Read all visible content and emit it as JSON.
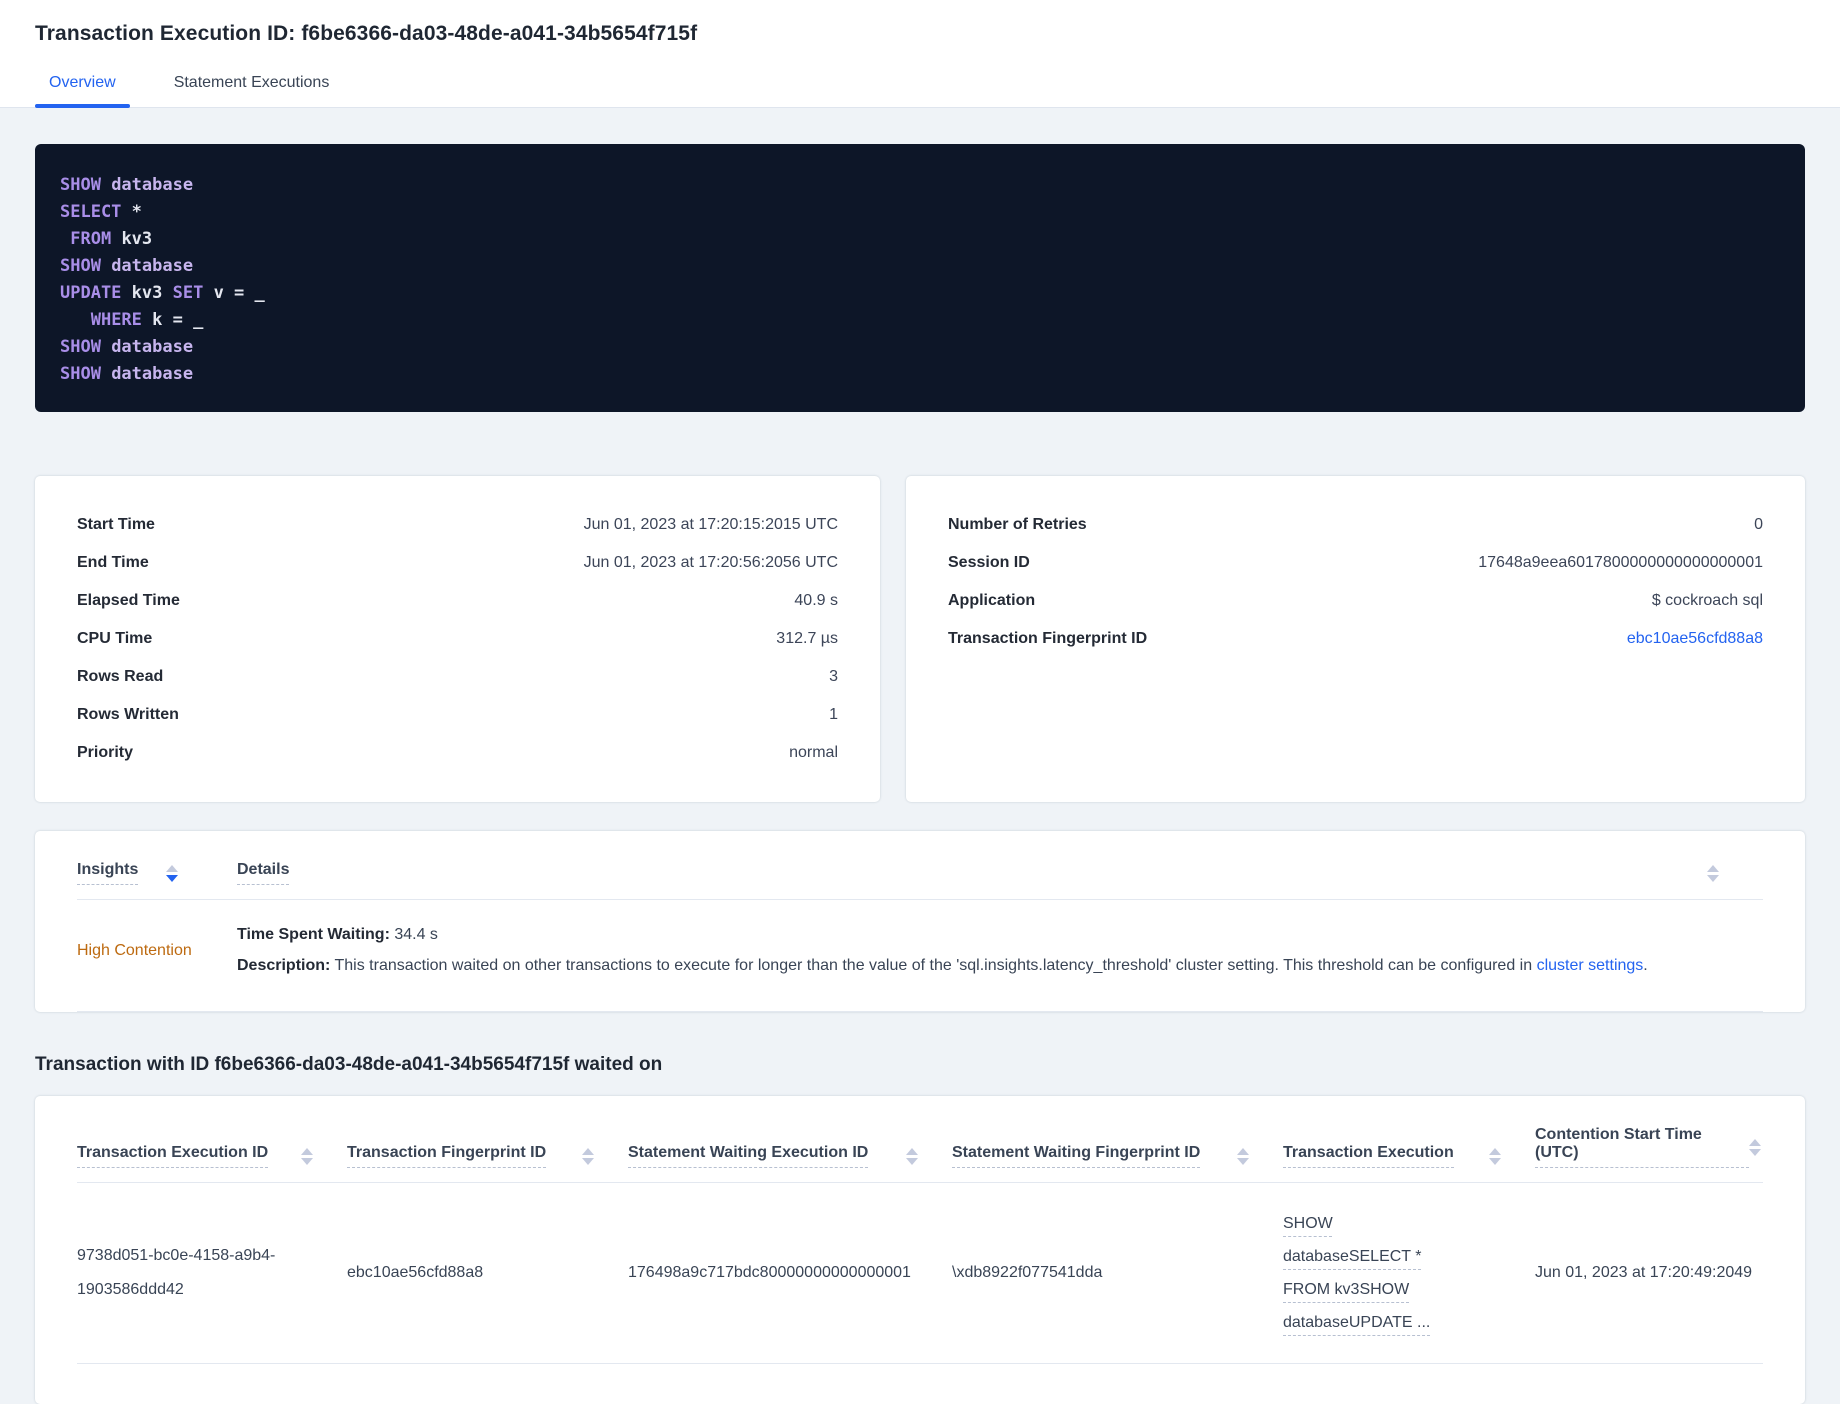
{
  "header": {
    "title": "Transaction Execution ID: f6be6366-da03-48de-a041-34b5654f715f",
    "tabs": [
      {
        "label": "Overview",
        "active": true
      },
      {
        "label": "Statement Executions",
        "active": false
      }
    ]
  },
  "colors": {
    "accent_blue": "#2363f0",
    "warning_orange": "#bd6a10",
    "code_background": "#0d1628",
    "code_keyword": "#a98ee8",
    "code_identifier": "#c7b5ee",
    "code_plain": "#e4e7f0"
  },
  "icons": {
    "sort_icon": "sort-arrows"
  },
  "sql_statements": {
    "lines": [
      {
        "tokens": [
          {
            "text": "SHOW ",
            "type": "kw"
          },
          {
            "text": "database",
            "type": "ident"
          }
        ]
      },
      {
        "tokens": [
          {
            "text": "SELECT ",
            "type": "kw"
          },
          {
            "text": "*",
            "type": "plain"
          }
        ]
      },
      {
        "tokens": [
          {
            "text": " ",
            "type": "plain"
          },
          {
            "text": "FROM ",
            "type": "kw"
          },
          {
            "text": "kv3",
            "type": "plain"
          }
        ]
      },
      {
        "tokens": [
          {
            "text": "SHOW ",
            "type": "kw"
          },
          {
            "text": "database",
            "type": "ident"
          }
        ]
      },
      {
        "tokens": [
          {
            "text": "UPDATE ",
            "type": "kw"
          },
          {
            "text": "kv3 ",
            "type": "plain"
          },
          {
            "text": "SET ",
            "type": "kw"
          },
          {
            "text": "v = _",
            "type": "plain"
          }
        ]
      },
      {
        "tokens": [
          {
            "text": "   ",
            "type": "plain"
          },
          {
            "text": "WHERE ",
            "type": "kw"
          },
          {
            "text": "k = _",
            "type": "plain"
          }
        ]
      },
      {
        "tokens": [
          {
            "text": "SHOW ",
            "type": "kw"
          },
          {
            "text": "database",
            "type": "ident"
          }
        ]
      },
      {
        "tokens": [
          {
            "text": "SHOW ",
            "type": "kw"
          },
          {
            "text": "database",
            "type": "ident"
          }
        ]
      }
    ]
  },
  "summary_left": {
    "rows": [
      {
        "label": "Start Time",
        "value": "Jun 01, 2023 at 17:20:15:2015 UTC"
      },
      {
        "label": "End Time",
        "value": "Jun 01, 2023 at 17:20:56:2056 UTC"
      },
      {
        "label": "Elapsed Time",
        "value": "40.9 s"
      },
      {
        "label": "CPU Time",
        "value": "312.7 µs"
      },
      {
        "label": "Rows Read",
        "value": "3"
      },
      {
        "label": "Rows Written",
        "value": "1"
      },
      {
        "label": "Priority",
        "value": "normal"
      }
    ]
  },
  "summary_right": {
    "rows": [
      {
        "label": "Number of Retries",
        "value": "0"
      },
      {
        "label": "Session ID",
        "value": "17648a9eea6017800000000000000001"
      },
      {
        "label": "Application",
        "value": "$ cockroach sql"
      },
      {
        "label": "Transaction Fingerprint ID",
        "value": "ebc10ae56cfd88a8",
        "link": true
      }
    ]
  },
  "insights_table": {
    "columns": [
      "Insights",
      "Details"
    ],
    "row": {
      "insight": "High Contention",
      "waiting_label": "Time Spent Waiting:",
      "waiting_value": "34.4 s",
      "description_label": "Description:",
      "description_text": "This transaction waited on other transactions to execute for longer than the value of the 'sql.insights.latency_threshold' cluster setting. This threshold can be configured in",
      "description_link": "cluster settings",
      "description_suffix": "."
    }
  },
  "waited_on": {
    "heading": "Transaction with ID f6be6366-da03-48de-a041-34b5654f715f waited on",
    "columns": [
      "Transaction Execution ID",
      "Transaction Fingerprint ID",
      "Statement Waiting Execution ID",
      "Statement Waiting Fingerprint ID",
      "Transaction Execution",
      "Contention Start Time (UTC)"
    ],
    "row": {
      "transaction_execution_id": "9738d051-bc0e-4158-a9b4-1903586ddd42",
      "transaction_fingerprint_id": "ebc10ae56cfd88a8",
      "statement_waiting_execution_id": "176498a9c717bdc80000000000000001",
      "statement_waiting_fingerprint_id": "\\xdb8922f077541dda",
      "transaction_execution": "SHOW databaseSELECT * FROM kv3SHOW databaseUPDATE ...",
      "contention_start_time": "Jun 01, 2023 at 17:20:49:2049"
    }
  }
}
